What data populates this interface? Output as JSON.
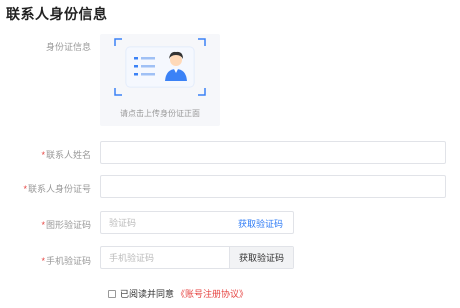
{
  "section_title": "联系人身份信息",
  "id_photo": {
    "label": "身份证信息",
    "upload_tip": "请点击上传身份证正面"
  },
  "fields": {
    "name": {
      "required_mark": "*",
      "label": "联系人姓名",
      "value": "",
      "placeholder": ""
    },
    "id_number": {
      "required_mark": "*",
      "label": "联系人身份证号",
      "value": "",
      "placeholder": ""
    },
    "image_captcha": {
      "required_mark": "*",
      "label": "图形验证码",
      "value": "",
      "placeholder": "验证码",
      "action_label": "获取验证码"
    },
    "sms_code": {
      "required_mark": "*",
      "label": "手机验证码",
      "value": "",
      "placeholder": "手机验证码",
      "action_label": "获取验证码"
    }
  },
  "agreement": {
    "text": "已阅读并同意",
    "link_text": "《账号注册协议》",
    "checked": false
  },
  "colors": {
    "accent": "#2f7cf6",
    "required": "#e64340",
    "card_blue": "#3b82f6"
  }
}
